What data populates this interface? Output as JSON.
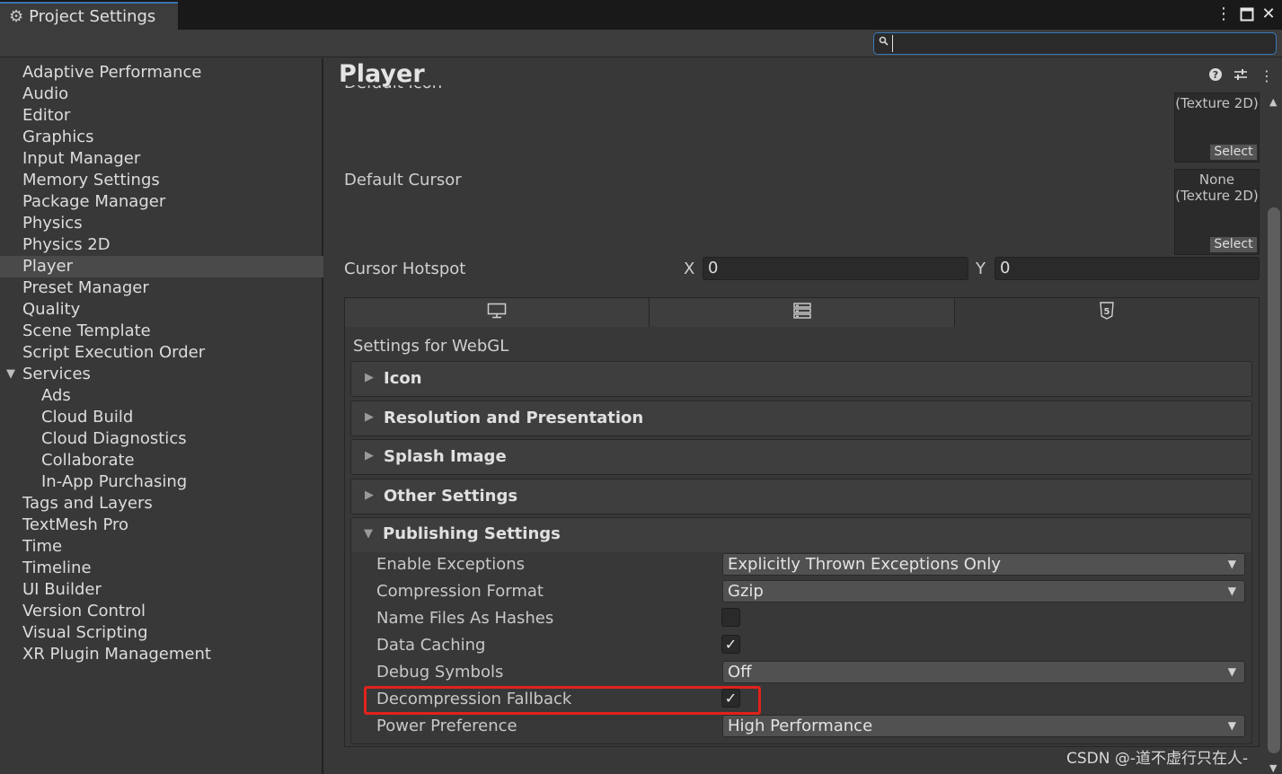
{
  "window": {
    "tab_title": "Project Settings",
    "search_value": ""
  },
  "sidebar": {
    "items": [
      {
        "label": "Adaptive Performance"
      },
      {
        "label": "Audio"
      },
      {
        "label": "Editor"
      },
      {
        "label": "Graphics"
      },
      {
        "label": "Input Manager"
      },
      {
        "label": "Memory Settings"
      },
      {
        "label": "Package Manager"
      },
      {
        "label": "Physics"
      },
      {
        "label": "Physics 2D"
      },
      {
        "label": "Player",
        "selected": true
      },
      {
        "label": "Preset Manager"
      },
      {
        "label": "Quality"
      },
      {
        "label": "Scene Template"
      },
      {
        "label": "Script Execution Order"
      },
      {
        "label": "Services",
        "expanded": true
      },
      {
        "label": "Ads",
        "child": true
      },
      {
        "label": "Cloud Build",
        "child": true
      },
      {
        "label": "Cloud Diagnostics",
        "child": true
      },
      {
        "label": "Collaborate",
        "child": true
      },
      {
        "label": "In-App Purchasing",
        "child": true
      },
      {
        "label": "Tags and Layers"
      },
      {
        "label": "TextMesh Pro"
      },
      {
        "label": "Time"
      },
      {
        "label": "Timeline"
      },
      {
        "label": "UI Builder"
      },
      {
        "label": "Version Control"
      },
      {
        "label": "Visual Scripting"
      },
      {
        "label": "XR Plugin Management"
      }
    ]
  },
  "main": {
    "title": "Player",
    "cut_label": "Default Icon",
    "default_icon": {
      "line1": "(Texture 2D)",
      "select": "Select"
    },
    "default_cursor": {
      "label": "Default Cursor",
      "line1": "None",
      "line2": "(Texture 2D)",
      "select": "Select"
    },
    "cursor_hotspot": {
      "label": "Cursor Hotspot",
      "x_label": "X",
      "x_value": "0",
      "y_label": "Y",
      "y_value": "0"
    },
    "platform_tabs": [
      {
        "icon": "monitor-icon"
      },
      {
        "icon": "server-icon"
      },
      {
        "icon": "html5-icon",
        "active": true
      }
    ],
    "settings_for": "Settings for WebGL",
    "sections": [
      {
        "label": "Icon"
      },
      {
        "label": "Resolution and Presentation"
      },
      {
        "label": "Splash Image"
      },
      {
        "label": "Other Settings"
      }
    ],
    "publishing": {
      "title": "Publishing Settings",
      "enable_exceptions": {
        "label": "Enable Exceptions",
        "value": "Explicitly Thrown Exceptions Only"
      },
      "compression_format": {
        "label": "Compression Format",
        "value": "Gzip"
      },
      "name_files_as_hashes": {
        "label": "Name Files As Hashes",
        "checked": false
      },
      "data_caching": {
        "label": "Data Caching",
        "checked": true,
        "mark": "✓"
      },
      "debug_symbols": {
        "label": "Debug Symbols",
        "value": "Off"
      },
      "decompression_fallback": {
        "label": "Decompression Fallback",
        "checked": true,
        "mark": "✓"
      },
      "power_preference": {
        "label": "Power Preference",
        "value": "High Performance"
      }
    }
  },
  "watermark": "CSDN @-道不虚行只在人-",
  "colors": {
    "highlight": "#e0231a",
    "accent": "#3a79bb"
  }
}
